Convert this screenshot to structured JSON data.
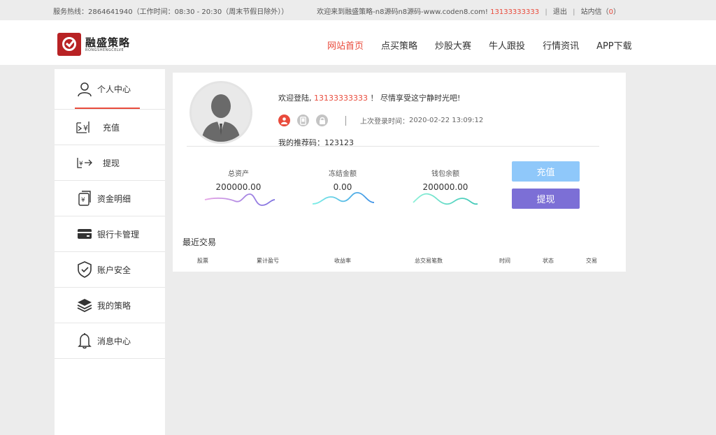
{
  "topbar": {
    "hotline": "服务热线：2864641940（工作时间：08:30 - 20:30（周末节假日除外））",
    "welcome_prefix": "欢迎来到融盛策略-n8源码n8源码-www.coden8.com!",
    "phone": "13133333333",
    "sep1": "|",
    "logout": "退出",
    "sep2": "|",
    "inbox": "站内信（",
    "inbox_count": "0",
    "inbox_close": "）"
  },
  "brand": {
    "name_cn": "融盛策略",
    "name_en": "RONGSHENGCELVE",
    "logo_color": "#b82224"
  },
  "nav": [
    "网站首页",
    "点买策略",
    "炒股大赛",
    "牛人跟投",
    "行情资讯",
    "APP下载"
  ],
  "nav_active_color": "#e94b3c",
  "sidebar": {
    "items": [
      {
        "label": "个人中心",
        "icon": "user-icon"
      },
      {
        "label": "充值",
        "icon": "recharge-icon"
      },
      {
        "label": "提现",
        "icon": "withdraw-icon"
      },
      {
        "label": "资金明细",
        "icon": "fund-detail-icon"
      },
      {
        "label": "银行卡管理",
        "icon": "bank-card-icon"
      },
      {
        "label": "账户安全",
        "icon": "shield-icon"
      },
      {
        "label": "我的策略",
        "icon": "layers-icon"
      },
      {
        "label": "消息中心",
        "icon": "bell-icon"
      }
    ]
  },
  "profile": {
    "welcome_prefix": "欢迎登陆,",
    "username": "13133333333",
    "welcome_suffix": "！ 尽情享受这宁静时光吧!",
    "last_login_label": "上次登录时间：",
    "last_login_time": "2020-02-22 13:09:12",
    "referral_label": "我的推荐码：",
    "referral_code": "123123"
  },
  "stats": [
    {
      "label": "总资产",
      "value": "200000.00"
    },
    {
      "label": "冻结金额",
      "value": "0.00"
    },
    {
      "label": "钱包余额",
      "value": "200000.00"
    }
  ],
  "actions": {
    "recharge": "充值",
    "withdraw": "提现"
  },
  "recent": {
    "title": "最近交易",
    "columns": [
      "股票",
      "累计盈亏",
      "收益率",
      "总交易笔数",
      "时间",
      "状态",
      "交易"
    ]
  }
}
